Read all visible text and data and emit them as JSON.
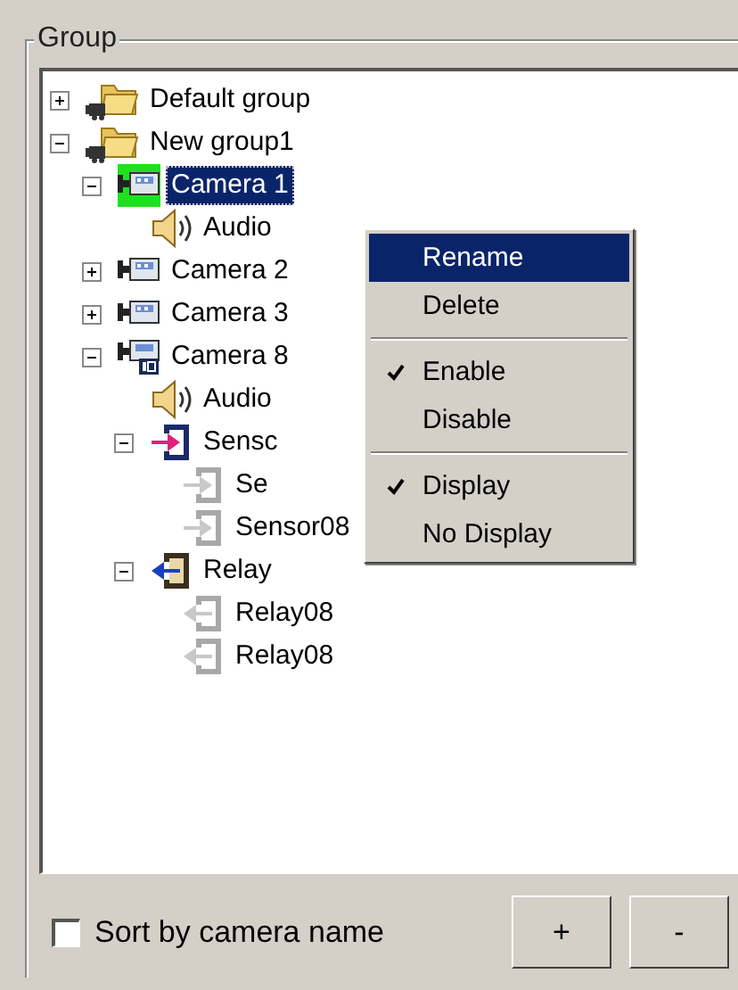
{
  "group_box": {
    "title": "Group"
  },
  "tree": [
    {
      "kind": "group",
      "label": "Default group",
      "expanded": false,
      "selected": false
    },
    {
      "kind": "group",
      "label": "New group1",
      "expanded": true,
      "selected": false,
      "children": [
        {
          "kind": "camera",
          "label": "Camera 1",
          "expanded": true,
          "selected": true,
          "children": [
            {
              "kind": "audio",
              "label": "Audio",
              "selected": false
            }
          ]
        },
        {
          "kind": "camera",
          "label": "Camera 2",
          "expanded": false,
          "selected": false
        },
        {
          "kind": "camera",
          "label": "Camera 3",
          "expanded": false,
          "selected": false
        },
        {
          "kind": "ip-camera",
          "label": "Camera 8",
          "expanded": true,
          "selected": false,
          "children": [
            {
              "kind": "audio",
              "label": "Audio",
              "selected": false
            },
            {
              "kind": "sensor-group",
              "label": "Sensc",
              "expanded": true,
              "selected": false,
              "children": [
                {
                  "kind": "sensor",
                  "label": "Se",
                  "selected": false
                },
                {
                  "kind": "sensor",
                  "label": "Sensor08",
                  "selected": false
                }
              ]
            },
            {
              "kind": "relay-group",
              "label": "Relay",
              "expanded": true,
              "selected": false,
              "children": [
                {
                  "kind": "relay",
                  "label": "Relay08",
                  "selected": false
                },
                {
                  "kind": "relay",
                  "label": "Relay08",
                  "selected": false
                }
              ]
            }
          ]
        }
      ]
    }
  ],
  "context_menu": [
    {
      "kind": "item",
      "label": "Rename",
      "checked": false,
      "selected": true
    },
    {
      "kind": "item",
      "label": "Delete",
      "checked": false,
      "selected": false
    },
    {
      "kind": "separator"
    },
    {
      "kind": "item",
      "label": "Enable",
      "checked": true,
      "selected": false
    },
    {
      "kind": "item",
      "label": "Disable",
      "checked": false,
      "selected": false
    },
    {
      "kind": "separator"
    },
    {
      "kind": "item",
      "label": "Display",
      "checked": true,
      "selected": false
    },
    {
      "kind": "item",
      "label": "No Display",
      "checked": false,
      "selected": false
    }
  ],
  "sort_checkbox": {
    "label": "Sort by camera name",
    "checked": false
  },
  "buttons": [
    "+",
    "-"
  ]
}
